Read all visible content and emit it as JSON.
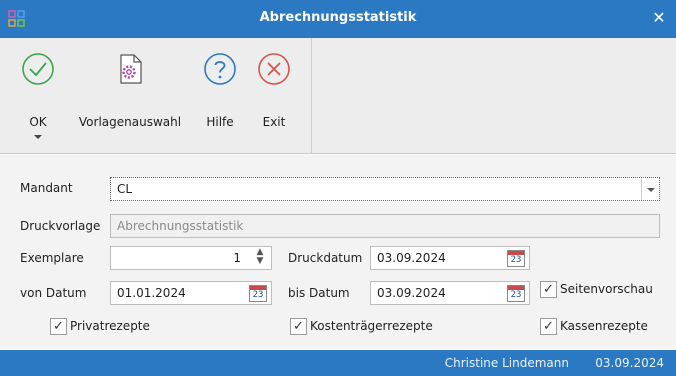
{
  "window": {
    "title": "Abrechnungsstatistik",
    "close_glyph": "✕"
  },
  "ribbon": {
    "buttons": [
      {
        "label": "OK",
        "icon": "check-circle-icon",
        "has_dropdown": true
      },
      {
        "label": "Vorlagenauswahl",
        "icon": "template-gear-document-icon"
      },
      {
        "label": "Hilfe",
        "icon": "question-circle-icon"
      },
      {
        "label": "Exit",
        "icon": "x-circle-icon"
      }
    ]
  },
  "form": {
    "mandant": {
      "label": "Mandant",
      "value": "CL"
    },
    "druckvorlage": {
      "label": "Druckvorlage",
      "value": "Abrechnungsstatistik"
    },
    "exemplare": {
      "label": "Exemplare",
      "value": "1"
    },
    "druckdatum": {
      "label": "Druckdatum",
      "value": "03.09.2024",
      "calendar_day": "23"
    },
    "von_datum": {
      "label": "von Datum",
      "value": "01.01.2024",
      "calendar_day": "23"
    },
    "bis_datum": {
      "label": "bis Datum",
      "value": "03.09.2024",
      "calendar_day": "23"
    },
    "seitenvorschau": {
      "label": "Seitenvorschau",
      "checked": true
    },
    "privatrezepte": {
      "label": "Privatrezepte",
      "checked": true
    },
    "kostentraegerrezepte": {
      "label": "Kostenträgerrezepte",
      "checked": true
    },
    "kassenrezepte": {
      "label": "Kassenrezepte",
      "checked": true
    },
    "check_glyph": "✓"
  },
  "status": {
    "user": "Christine Lindemann",
    "date": "03.09.2024"
  },
  "colors": {
    "titlebar": "#2b79c2",
    "ok_icon": "#3aa64a",
    "help_icon": "#2b79c2",
    "exit_icon": "#d9534f",
    "gear_icon": "#b04aa8"
  }
}
